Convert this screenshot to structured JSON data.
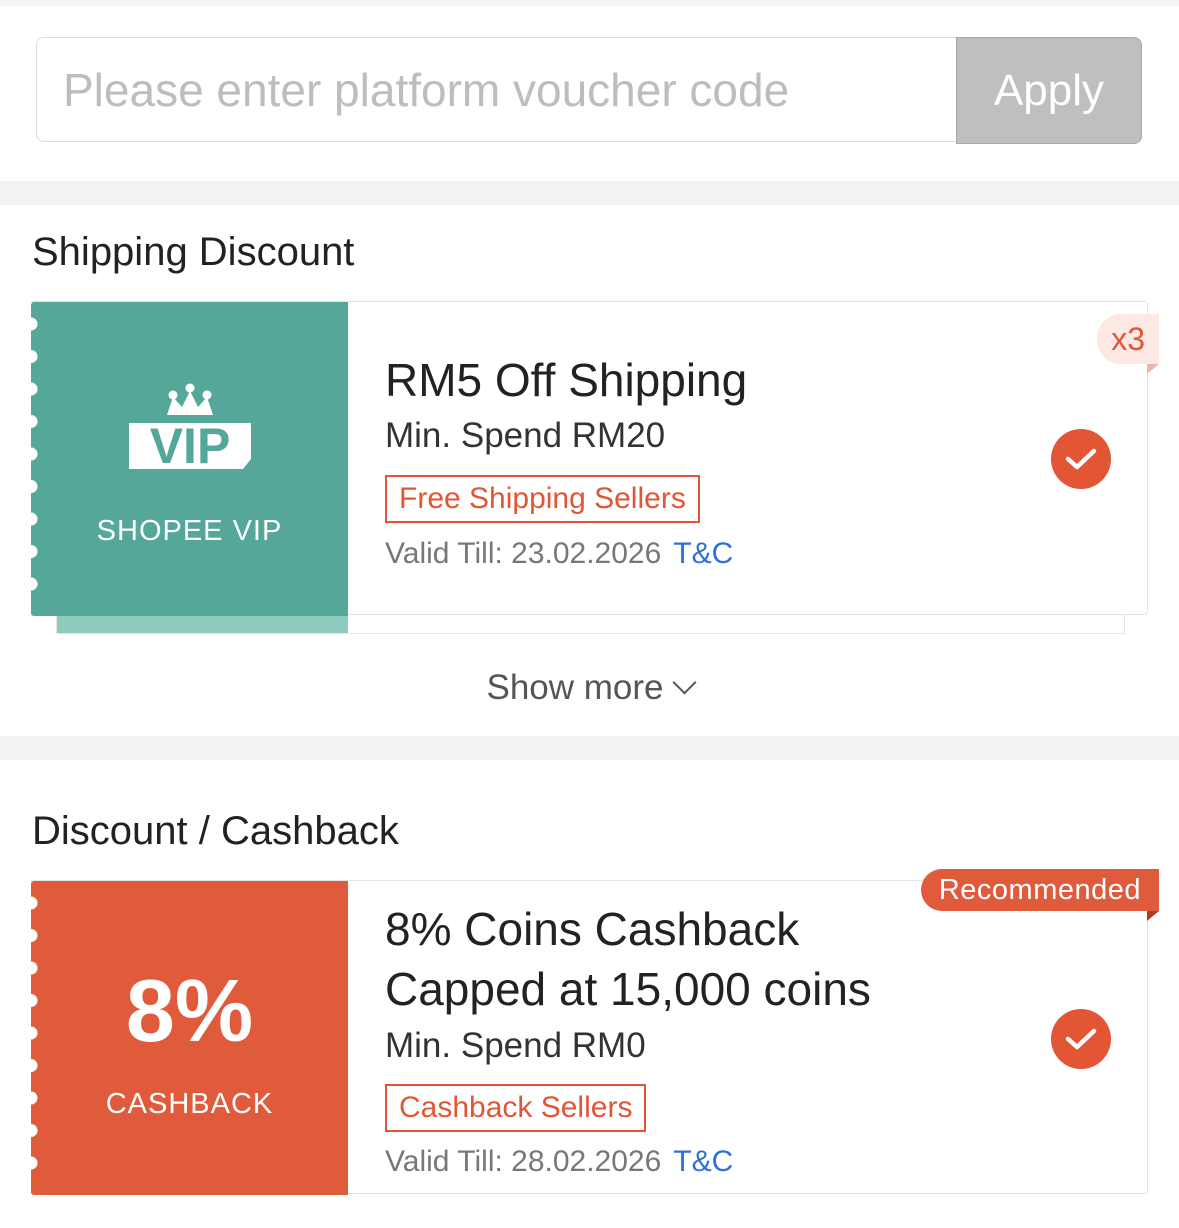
{
  "voucher_input": {
    "placeholder": "Please enter platform voucher code",
    "apply_label": "Apply"
  },
  "shipping_section": {
    "title": "Shipping Discount",
    "voucher": {
      "stub_logo_text": "VIP",
      "stub_label": "SHOPEE VIP",
      "stub_color": "#55a899",
      "title": "RM5 Off Shipping",
      "min_spend": "Min. Spend RM20",
      "tag": "Free Shipping Sellers",
      "valid_till": "Valid Till: 23.02.2026",
      "tnc": "T&C",
      "count_badge": "x3",
      "selected": true
    },
    "show_more": "Show more"
  },
  "discount_section": {
    "title": "Discount / Cashback",
    "voucher": {
      "stub_value": "8%",
      "stub_label": "CASHBACK",
      "stub_color": "#e05a3c",
      "badge": "Recommended",
      "title_line1": "8% Coins Cashback",
      "title_line2": "Capped at 15,000 coins",
      "min_spend": "Min. Spend RM0",
      "tag": "Cashback Sellers",
      "valid_till": "Valid Till: 28.02.2026",
      "tnc": "T&C",
      "selected": true
    }
  },
  "colors": {
    "accent": "#e25535",
    "link": "#2f6fd6",
    "vip_green": "#55a899",
    "disabled_button": "#bfbfbf"
  }
}
